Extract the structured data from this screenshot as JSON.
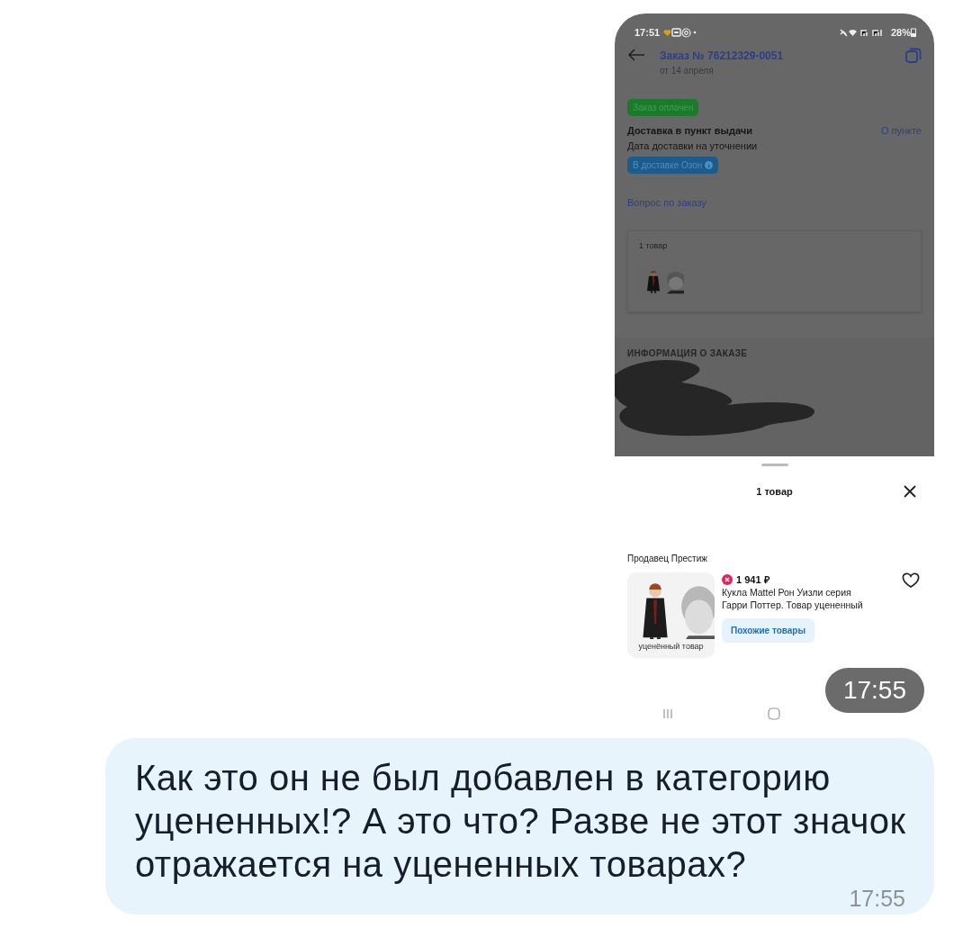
{
  "message": {
    "image": {
      "status_bar": {
        "time": "17:51",
        "battery": "28%"
      },
      "header": {
        "title": "Заказ № 76212329-0051",
        "subtitle": "от 14 апреля"
      },
      "status_badge": "Заказ оплачен",
      "delivery": {
        "title": "Доставка в пункт выдачи",
        "link": "О пункте",
        "date": "Дата доставки на уточнении",
        "badge": "В доставке Озон"
      },
      "question_link": "Вопрос по заказу",
      "items_card": {
        "count": "1 товар"
      },
      "info_section": {
        "title": "ИНФОРМАЦИЯ О ЗАКАЗЕ"
      },
      "sheet": {
        "title": "1 товар",
        "seller": "Продавец Престиж",
        "product": {
          "price": "1 941 ₽",
          "name": "Кукла Mattel Рон Уизли серия Гарри Поттер. Товар уцененный",
          "image_caption": "уценённый товар",
          "button": "Похожие товары"
        }
      },
      "time": "17:55"
    },
    "text": "Как это он не был добавлен в категорию уцененных!? А это что? Разве не этот значок отражается на уцененных товарах?",
    "time": "17:55"
  }
}
